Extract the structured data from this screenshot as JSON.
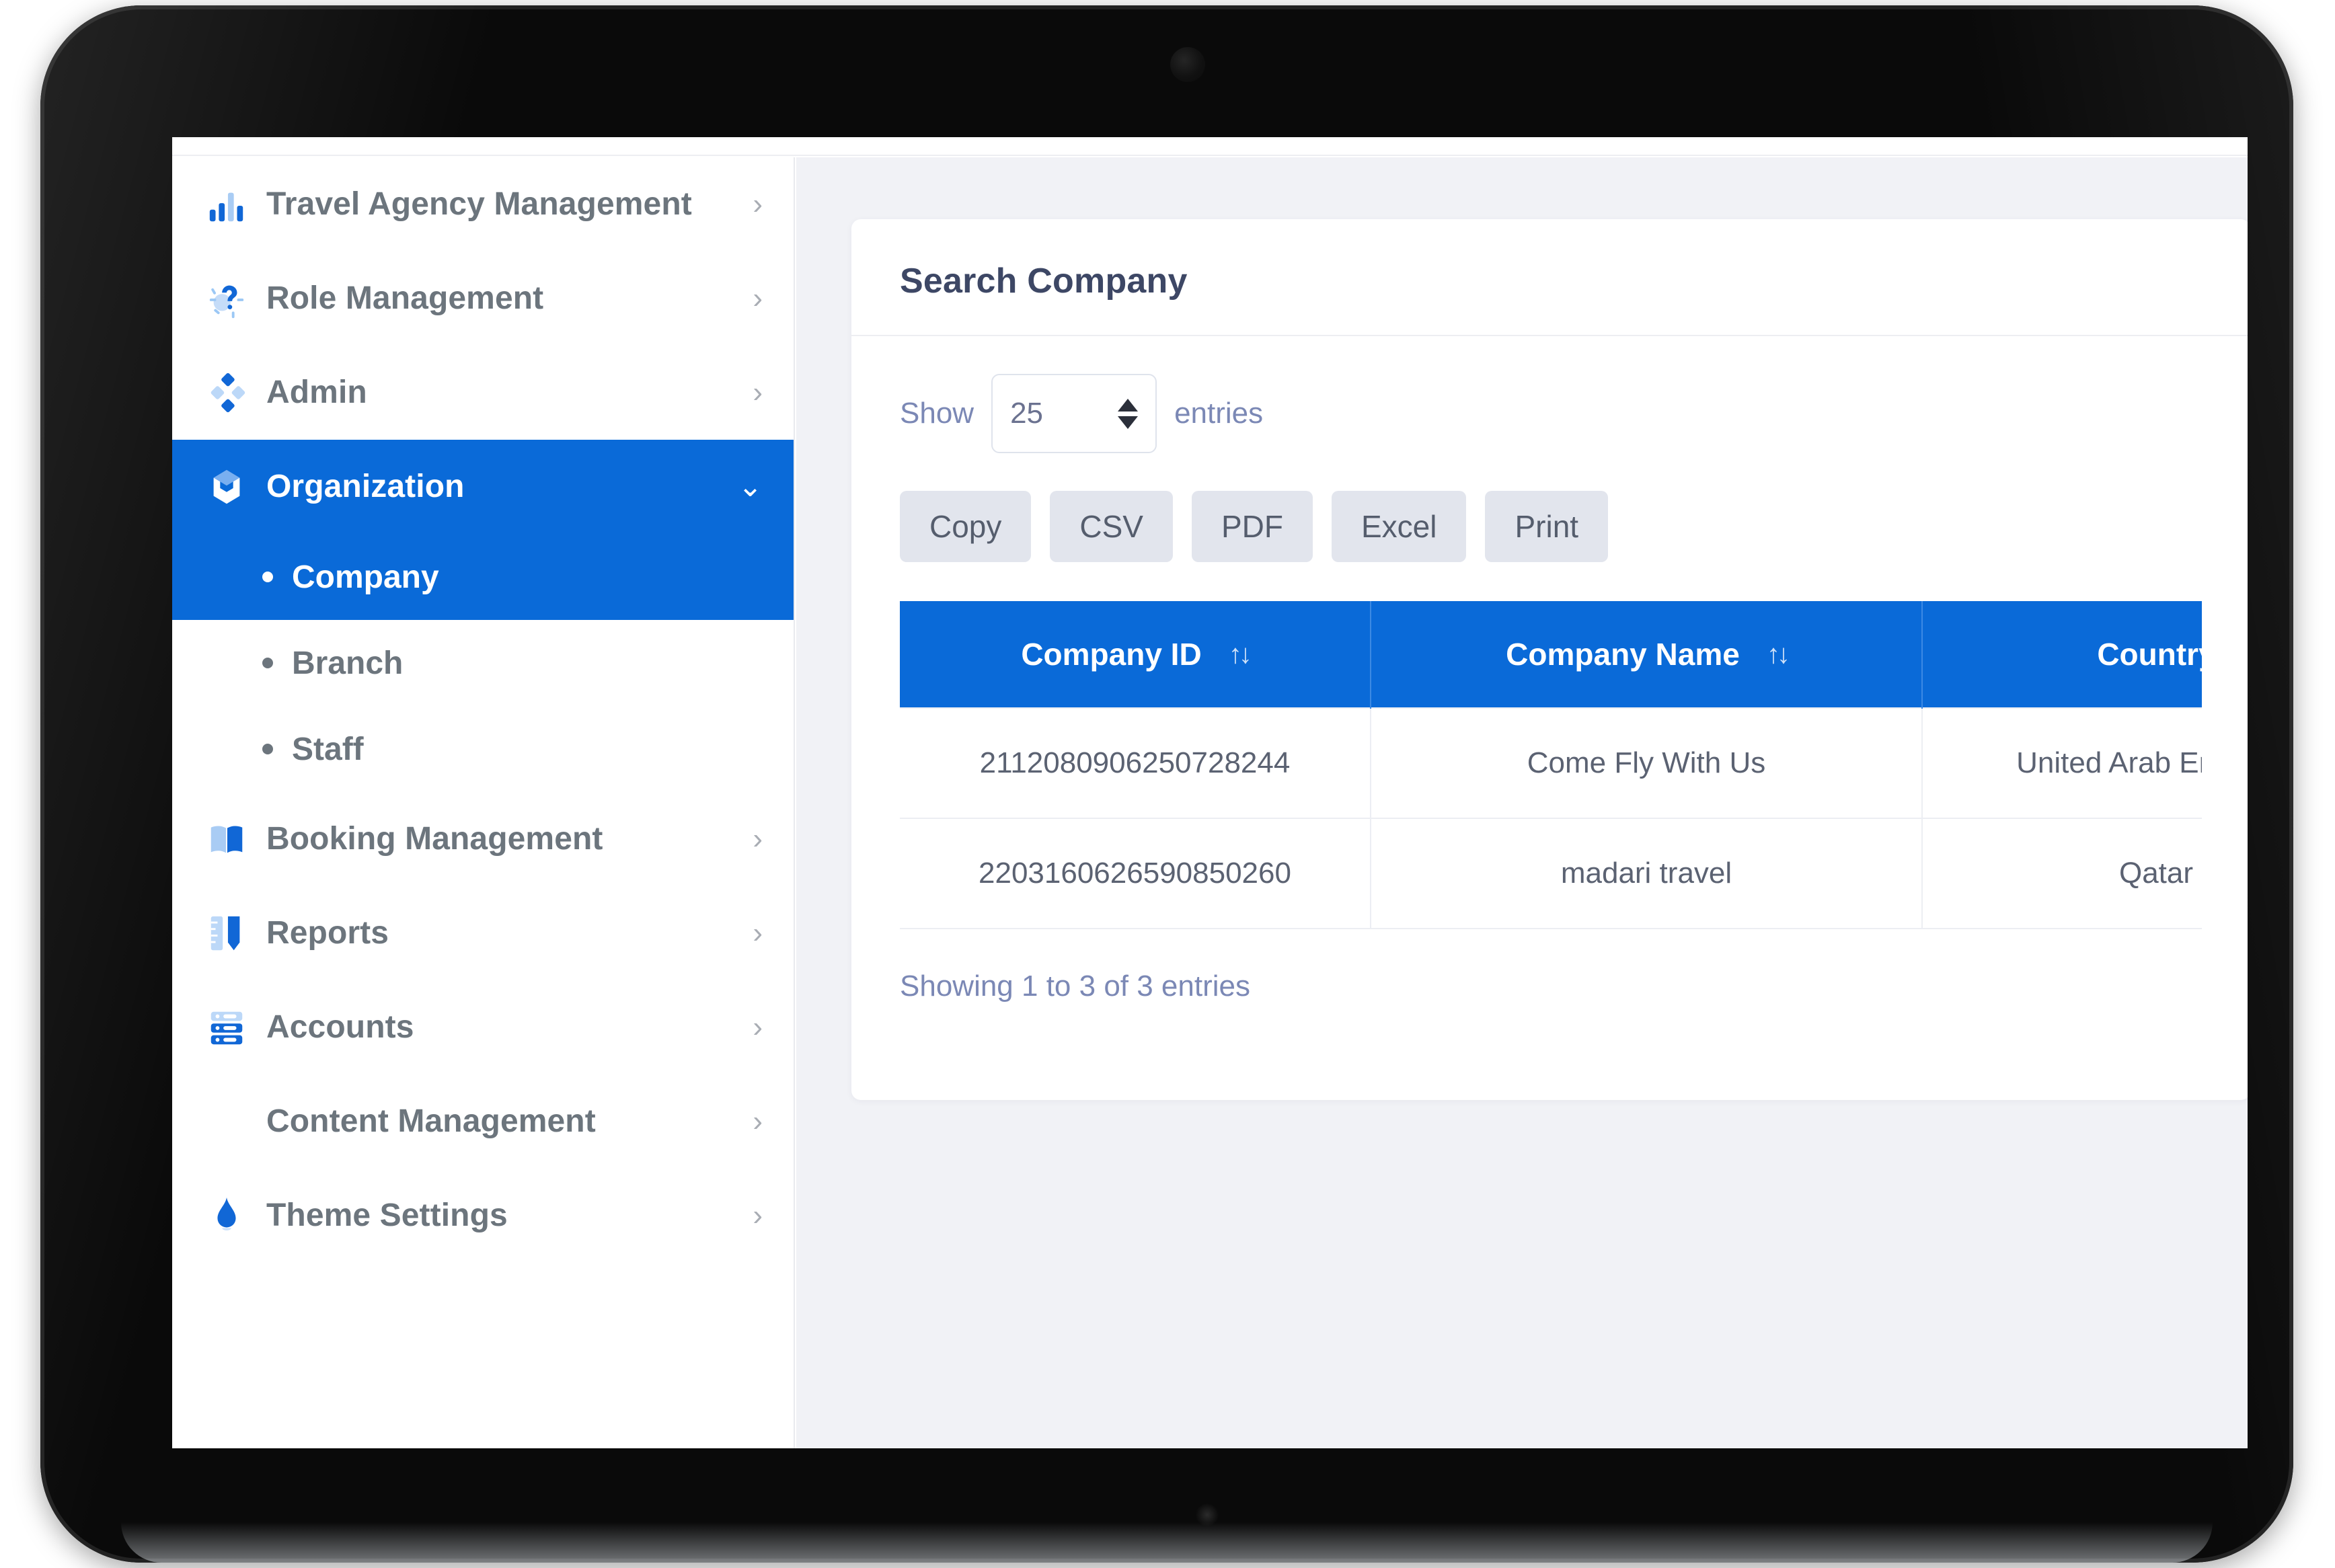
{
  "sidebar": {
    "items": [
      {
        "label": "Travel Agency Management",
        "icon": "bar-chart-icon",
        "caret": "›",
        "active": false,
        "has_icon": true
      },
      {
        "label": "Role Management",
        "icon": "user-role-icon",
        "caret": "›",
        "active": false,
        "has_icon": true
      },
      {
        "label": "Admin",
        "icon": "diamonds-icon",
        "caret": "›",
        "active": false,
        "has_icon": true
      },
      {
        "label": "Organization",
        "icon": "cube-icon",
        "caret": "⌄",
        "active": true,
        "has_icon": true
      },
      {
        "label": "Booking Management",
        "icon": "open-book-icon",
        "caret": "›",
        "active": false,
        "has_icon": true
      },
      {
        "label": "Reports",
        "icon": "ruler-pen-icon",
        "caret": "›",
        "active": false,
        "has_icon": true
      },
      {
        "label": "Accounts",
        "icon": "server-stack-icon",
        "caret": "›",
        "active": false,
        "has_icon": true
      },
      {
        "label": "Content Management",
        "icon": "none",
        "caret": "›",
        "active": false,
        "has_icon": false
      },
      {
        "label": "Theme Settings",
        "icon": "water-drop-icon",
        "caret": "›",
        "active": false,
        "has_icon": true
      }
    ],
    "submenu": [
      {
        "label": "Company",
        "active": true
      },
      {
        "label": "Branch",
        "active": false
      },
      {
        "label": "Staff",
        "active": false
      }
    ]
  },
  "card": {
    "title": "Search Company",
    "length_menu": {
      "prefix": "Show",
      "value": "25",
      "suffix": "entries"
    },
    "export_buttons": [
      "Copy",
      "CSV",
      "PDF",
      "Excel",
      "Print"
    ],
    "table": {
      "columns": [
        "Company ID",
        "Company Name",
        "Country"
      ],
      "sort_icon": "↑↓",
      "rows": [
        [
          "2112080906250728244",
          "Come Fly With Us",
          "United Arab Emirates"
        ],
        [
          "2203160626590850260",
          "madari travel",
          "Qatar"
        ]
      ]
    },
    "info": "Showing 1 to 3 of 3 entries"
  },
  "colors": {
    "accent": "#0a6ad8",
    "sidebar_text": "#6c757d",
    "card_title": "#3d4765",
    "muted_blue": "#7b88b5",
    "export_btn_bg": "#e2e5ed",
    "content_bg": "#f1f2f6"
  }
}
